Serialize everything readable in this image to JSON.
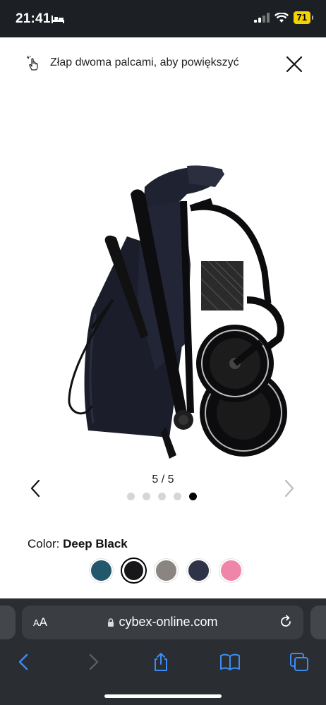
{
  "status_bar": {
    "time": "21:41",
    "battery": "71"
  },
  "viewer": {
    "hint": "Złap dwoma palcami, aby powiększyć",
    "page_counter": "5 / 5",
    "dot_count": 5,
    "active_index": 4
  },
  "product": {
    "color_label": "Color:",
    "color_name": "Deep Black",
    "swatches": [
      {
        "name": "teal",
        "hex": "#23586c"
      },
      {
        "name": "deep-black",
        "hex": "#17171a",
        "selected": true
      },
      {
        "name": "grey",
        "hex": "#8a8580"
      },
      {
        "name": "navy",
        "hex": "#2e3347"
      },
      {
        "name": "pink",
        "hex": "#ef86aa"
      }
    ]
  },
  "browser": {
    "aa_label_small": "A",
    "aa_label_big": "A",
    "url": "cybex-online.com"
  }
}
